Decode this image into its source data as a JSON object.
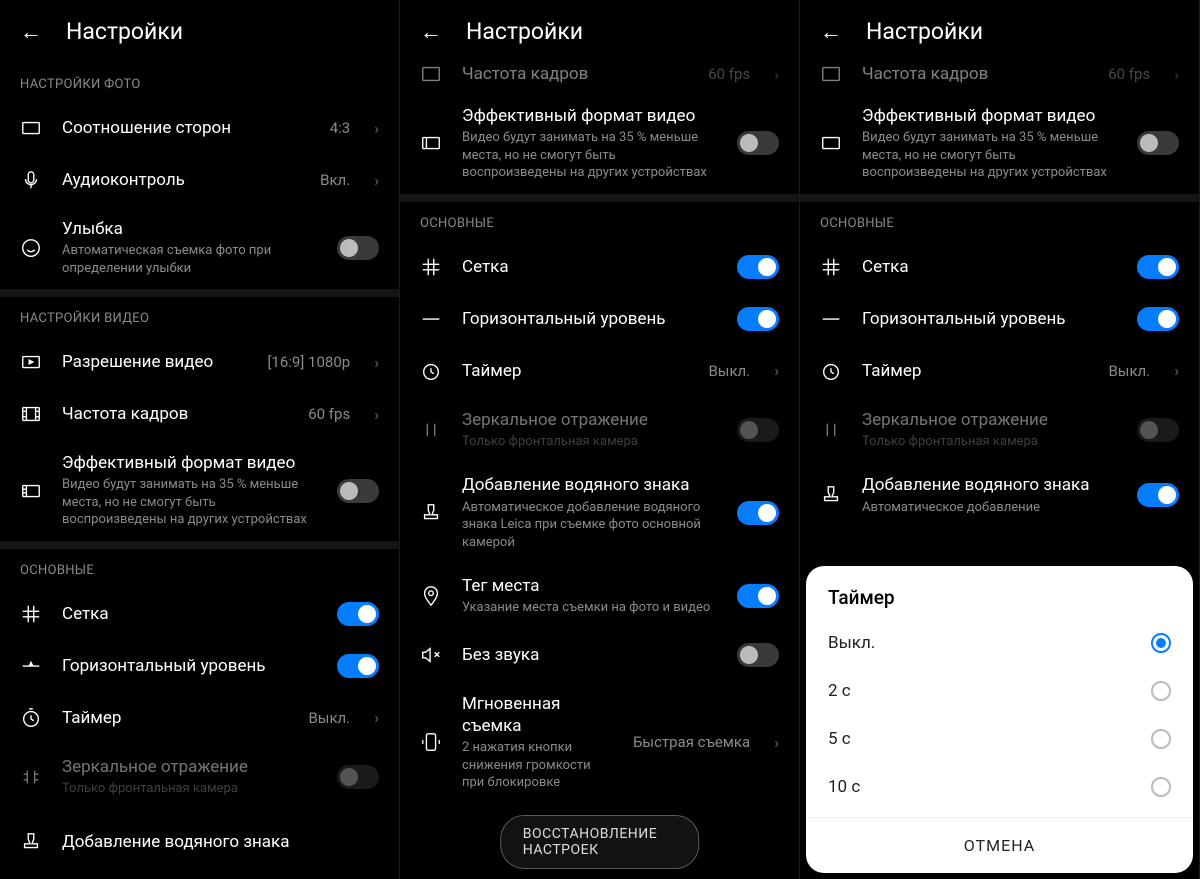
{
  "header": {
    "title": "Настройки"
  },
  "sections": {
    "photo": "НАСТРОЙКИ ФОТО",
    "video": "НАСТРОЙКИ ВИДЕО",
    "general": "ОСНОВНЫЕ"
  },
  "rows": {
    "aspect_ratio": {
      "label": "Соотношение сторон",
      "value": "4:3"
    },
    "audio_control": {
      "label": "Аудиоконтроль",
      "value": "Вкл."
    },
    "smile": {
      "label": "Улыбка",
      "sub": "Автоматическая съемка фото при определении улыбки"
    },
    "video_res": {
      "label": "Разрешение видео",
      "value": "[16:9] 1080p"
    },
    "frame_rate": {
      "label": "Частота кадров",
      "value": "60 fps"
    },
    "eff_video": {
      "label": "Эффективный формат видео",
      "sub": "Видео будут занимать на 35 % меньше места, но не смогут быть воспроизведены на других устройствах"
    },
    "grid": {
      "label": "Сетка"
    },
    "horizon": {
      "label": "Горизонтальный уровень"
    },
    "timer": {
      "label": "Таймер",
      "value": "Выкл."
    },
    "mirror": {
      "label": "Зеркальное отражение",
      "sub": "Только фронтальная камера"
    },
    "watermark": {
      "label": "Добавление водяного знака",
      "sub": "Автоматическое добавление водяного знака Leica при съемке фото основной камерой"
    },
    "watermark_short": {
      "label": "Добавление водяного знака",
      "sub": "Автоматическое добавление"
    },
    "geo": {
      "label": "Тег места",
      "sub": "Указание места съемки на фото и видео"
    },
    "mute": {
      "label": "Без звука"
    },
    "quick": {
      "label": "Мгновенная съемка",
      "sub": "2 нажатия кнопки снижения громкости при блокировке",
      "value": "Быстрая съемка"
    },
    "frame_rate_cut": {
      "label": "Частота кадров",
      "value": "60 fps"
    }
  },
  "restore": "ВОССТАНОВЛЕНИЕ НАСТРОЕК",
  "dialog": {
    "title": "Таймер",
    "options": [
      "Выкл.",
      "2 с",
      "5 с",
      "10 с"
    ],
    "cancel": "ОТМЕНА"
  }
}
